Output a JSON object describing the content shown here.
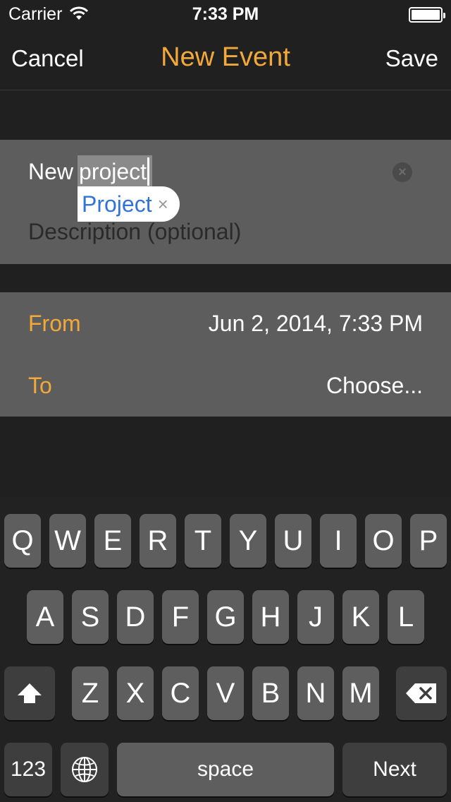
{
  "status_bar": {
    "carrier": "Carrier",
    "time": "7:33 PM"
  },
  "nav": {
    "cancel": "Cancel",
    "title": "New Event",
    "save": "Save"
  },
  "event": {
    "title_prefix": "New",
    "title_selected": "project",
    "suggestion": "Project",
    "suggestion_dismiss": "×",
    "description_placeholder": "Description (optional)",
    "clear": "×"
  },
  "dates": {
    "from_label": "From",
    "from_value": "Jun 2, 2014, 7:33 PM",
    "to_label": "To",
    "to_value": "Choose..."
  },
  "keyboard": {
    "row1": [
      "Q",
      "W",
      "E",
      "R",
      "T",
      "Y",
      "U",
      "I",
      "O",
      "P"
    ],
    "row2": [
      "A",
      "S",
      "D",
      "F",
      "G",
      "H",
      "J",
      "K",
      "L"
    ],
    "row3": [
      "Z",
      "X",
      "C",
      "V",
      "B",
      "N",
      "M"
    ],
    "numbers": "123",
    "space": "space",
    "return": "Next"
  },
  "colors": {
    "accent": "#f2a93a",
    "suggestion": "#2f74d6"
  }
}
